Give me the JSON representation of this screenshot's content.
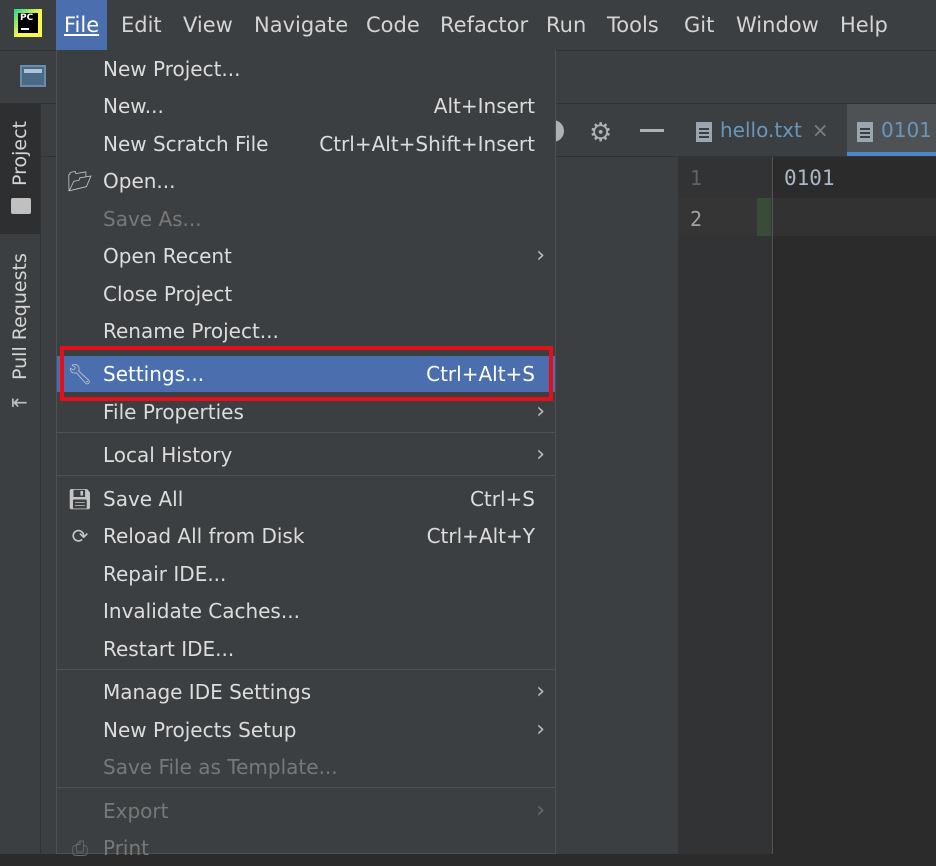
{
  "app": {
    "logo_text": "PC"
  },
  "menubar": {
    "items": [
      {
        "label": "File",
        "active": true
      },
      {
        "label": "Edit"
      },
      {
        "label": "View"
      },
      {
        "label": "Navigate"
      },
      {
        "label": "Code"
      },
      {
        "label": "Refactor"
      },
      {
        "label": "Run"
      },
      {
        "label": "Tools"
      },
      {
        "label": "Git"
      },
      {
        "label": "Window"
      },
      {
        "label": "Help"
      }
    ]
  },
  "sidebar": {
    "tabs": [
      {
        "label": "Project",
        "icon": "folder-icon",
        "selected": true
      },
      {
        "label": "Pull Requests",
        "icon": "pull-request-icon"
      }
    ]
  },
  "editor": {
    "tabs": [
      {
        "label": "hello.txt",
        "close": "×"
      },
      {
        "label": "0101",
        "active": true
      }
    ],
    "line_numbers": [
      "1",
      "2"
    ],
    "lines": [
      "0101",
      ""
    ]
  },
  "file_menu": {
    "items": [
      {
        "label": "New Project...",
        "shortcut": ""
      },
      {
        "label": "New...",
        "shortcut": "Alt+Insert"
      },
      {
        "label": "New Scratch File",
        "shortcut": "Ctrl+Alt+Shift+Insert"
      },
      {
        "label": "Open...",
        "shortcut": "",
        "icon": "folder-open-icon"
      },
      {
        "label": "Save As...",
        "shortcut": "",
        "disabled": true
      },
      {
        "label": "Open Recent",
        "submenu": true
      },
      {
        "label": "Close Project"
      },
      {
        "label": "Rename Project..."
      },
      {
        "label": "Settings...",
        "shortcut": "Ctrl+Alt+S",
        "icon": "wrench-icon",
        "selected": true
      },
      {
        "label": "File Properties",
        "submenu": true
      },
      {
        "label": "Local History",
        "submenu": true
      },
      {
        "label": "Save All",
        "shortcut": "Ctrl+S",
        "icon": "save-icon"
      },
      {
        "label": "Reload All from Disk",
        "shortcut": "Ctrl+Alt+Y",
        "icon": "reload-icon"
      },
      {
        "label": "Repair IDE..."
      },
      {
        "label": "Invalidate Caches..."
      },
      {
        "label": "Restart IDE..."
      },
      {
        "label": "Manage IDE Settings",
        "submenu": true
      },
      {
        "label": "New Projects Setup",
        "submenu": true
      },
      {
        "label": "Save File as Template...",
        "disabled": true
      },
      {
        "label": "Export",
        "submenu": true,
        "disabled": true
      },
      {
        "label": "Print",
        "disabled": true,
        "icon": "print-icon"
      }
    ],
    "arrow_glyph": "›"
  },
  "colors": {
    "accent": "#4b6eaf",
    "highlight_border": "#e3101b"
  }
}
